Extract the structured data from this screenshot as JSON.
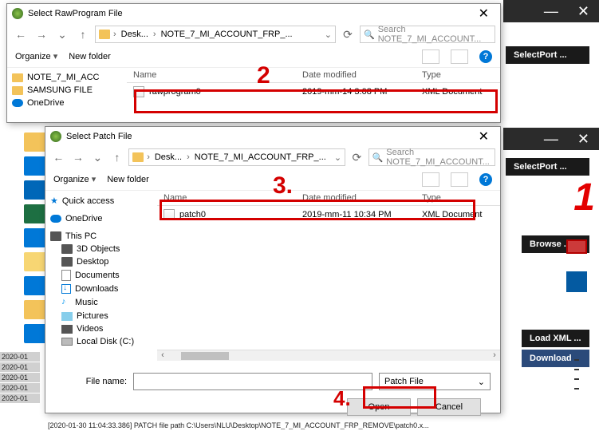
{
  "bgApp": {
    "min": "—",
    "close": "✕",
    "selectPort": "SelectPort ...",
    "browse": "Browse ...",
    "loadXml": "Load XML ...",
    "download": "Download",
    "redOne": "1"
  },
  "dlg1": {
    "title": "Select RawProgram File",
    "close": "✕",
    "nav": {
      "back": "←",
      "fwd": "→",
      "up": "↑",
      "refresh": "⟳",
      "dropdown": "⌄"
    },
    "breadcrumb": {
      "seg1": "Desk...",
      "seg2": "NOTE_7_MI_ACCOUNT_FRP_..."
    },
    "searchPlaceholder": "Search NOTE_7_MI_ACCOUNT...",
    "toolbar": {
      "organize": "Organize",
      "newFolder": "New folder",
      "help": "?"
    },
    "tree": {
      "item1": "NOTE_7_MI_ACC",
      "item2": "SAMSUNG FILE",
      "item3": "OneDrive"
    },
    "cols": {
      "name": "Name",
      "date": "Date modified",
      "type": "Type"
    },
    "row": {
      "name": "rawprogram0",
      "date": "2019-mm-14 3:08 PM",
      "type": "XML Document"
    }
  },
  "dlg2": {
    "title": "Select Patch File",
    "close": "✕",
    "nav": {
      "back": "←",
      "fwd": "→",
      "up": "↑",
      "refresh": "⟳",
      "dropdown": "⌄"
    },
    "breadcrumb": {
      "seg1": "Desk...",
      "seg2": "NOTE_7_MI_ACCOUNT_FRP_..."
    },
    "searchPlaceholder": "Search NOTE_7_MI_ACCOUNT...",
    "toolbar": {
      "organize": "Organize",
      "newFolder": "New folder",
      "help": "?"
    },
    "tree": {
      "quick": "Quick access",
      "onedrive": "OneDrive",
      "thispc": "This PC",
      "obj3d": "3D Objects",
      "desktop": "Desktop",
      "docs": "Documents",
      "downloads": "Downloads",
      "music": "Music",
      "pictures": "Pictures",
      "videos": "Videos",
      "disk": "Local Disk (C:)"
    },
    "cols": {
      "name": "Name",
      "date": "Date modified",
      "type": "Type"
    },
    "row": {
      "name": "patch0",
      "date": "2019-mm-11 10:34 PM",
      "type": "XML Document"
    },
    "filenameLabel": "File name:",
    "filenameValue": "",
    "filterValue": "Patch File",
    "openBtn": "Open",
    "cancelBtn": "Cancel"
  },
  "annotations": {
    "a2": "2",
    "a3": "3.",
    "a4": "4."
  },
  "dates": [
    "2020-01",
    "2020-01",
    "2020-01",
    "2020-01",
    "2020-01"
  ],
  "statusLine": "[2020-01-30 11:04:33.386]  PATCH file path C:\\Users\\NLU\\Desktop\\NOTE_7_MI_ACCOUNT_FRP_REMOVE\\patch0.x..."
}
